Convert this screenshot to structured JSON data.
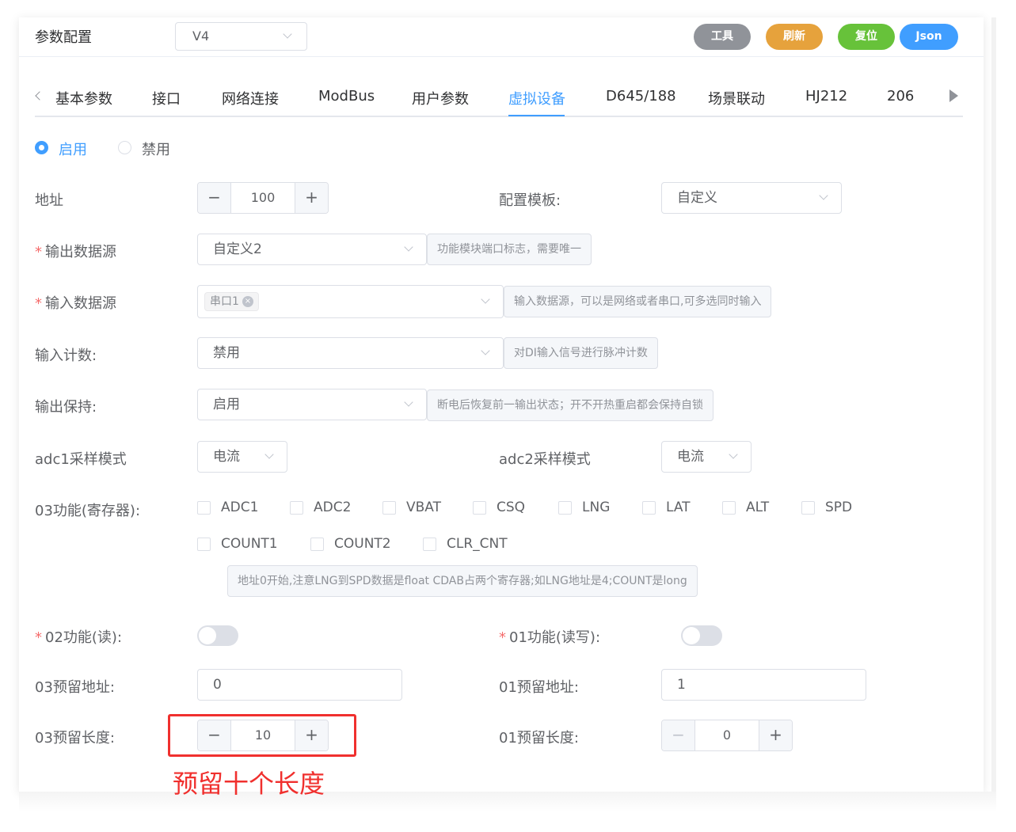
{
  "header": {
    "title": "参数配置",
    "version_value": "V4",
    "buttons": [
      {
        "label": "工具",
        "color": "#909399"
      },
      {
        "label": "刷新",
        "color": "#e6a23c"
      },
      {
        "label": "复位",
        "color": "#67c23a"
      },
      {
        "label": "Json",
        "color": "#409eff"
      }
    ]
  },
  "tabs": [
    {
      "label": "基本参数"
    },
    {
      "label": "接口"
    },
    {
      "label": "网络连接"
    },
    {
      "label": "ModBus"
    },
    {
      "label": "用户参数"
    },
    {
      "label": "虚拟设备",
      "active": true
    },
    {
      "label": "D645/188"
    },
    {
      "label": "场景联动"
    },
    {
      "label": "HJ212"
    },
    {
      "label": "206"
    }
  ],
  "status": {
    "enable_label": "启用",
    "disable_label": "禁用",
    "selected": "启用"
  },
  "form": {
    "address": {
      "label": "地址",
      "value": "100"
    },
    "template": {
      "label": "配置模板:",
      "value": "自定义"
    },
    "output_source": {
      "label": "输出数据源",
      "required_mark": "*",
      "value": "自定义2",
      "hint": "功能模块端口标志，需要唯一"
    },
    "input_source": {
      "label": "输入数据源",
      "required_mark": "*",
      "tag": "串口1",
      "hint": "输入数据源，可以是网络或者串口,可多选同时输入"
    },
    "input_count": {
      "label": "输入计数:",
      "value": "禁用",
      "hint": "对DI输入信号进行脉冲计数"
    },
    "output_hold": {
      "label": "输出保持:",
      "value": "启用",
      "hint": "断电后恢复前一输出状态；开不开热重启都会保持自锁"
    },
    "adc1": {
      "label": "adc1采样模式",
      "value": "电流"
    },
    "adc2": {
      "label": "adc2采样模式",
      "value": "电流"
    },
    "func03": {
      "label": "03功能(寄存器):",
      "options": [
        "ADC1",
        "ADC2",
        "VBAT",
        "CSQ",
        "LNG",
        "LAT",
        "ALT",
        "SPD",
        "COUNT1",
        "COUNT2",
        "CLR_CNT"
      ],
      "hint": "地址0开始,注意LNG到SPD数据是float CDAB占两个寄存器;如LNG地址是4;COUNT是long"
    },
    "func02": {
      "label": "02功能(读):",
      "required_mark": "*",
      "enabled": false
    },
    "func01": {
      "label": "01功能(读写):",
      "required_mark": "*",
      "enabled": false
    },
    "reserve03_addr": {
      "label": "03预留地址:",
      "value": "0"
    },
    "reserve01_addr": {
      "label": "01预留地址:",
      "value": "1"
    },
    "reserve03_len": {
      "label": "03预留长度:",
      "value": "10"
    },
    "reserve01_len": {
      "label": "01预留长度:",
      "value": "0"
    }
  },
  "annotation": {
    "text": "预留十个长度",
    "color": "#f0302e"
  },
  "icons": {
    "minus": "−",
    "plus": "+",
    "tag_close": "×"
  }
}
